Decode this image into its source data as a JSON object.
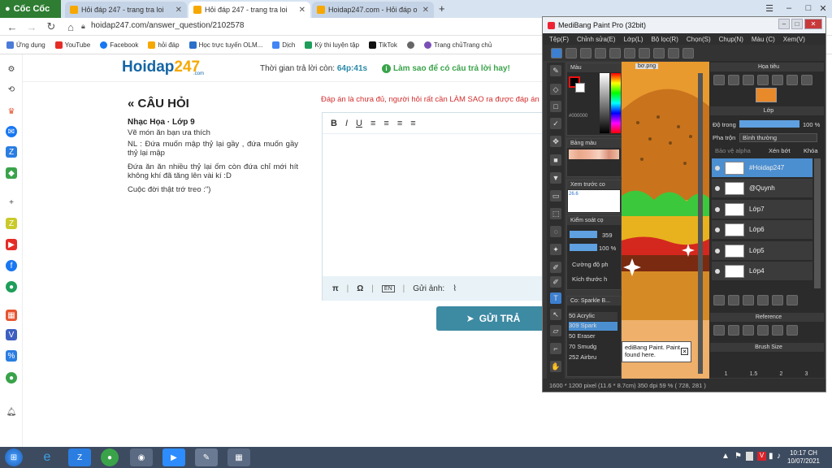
{
  "browser": {
    "brand": "Cốc Cốc",
    "tabs": [
      {
        "title": "Hỏi đáp 247 - trang tra loi",
        "active": false
      },
      {
        "title": "Hỏi đáp 247 - trang tra loi",
        "active": true
      },
      {
        "title": "Hoidap247.com - Hỏi đáp o",
        "active": false
      }
    ],
    "url": "hoidap247.com/answer_question/2102578",
    "bookmarks": [
      "Ứng dụng",
      "YouTube",
      "Facebook",
      "hỏi đáp",
      "Học trực tuyến OLM...",
      "Dịch",
      "Kỳ thi luyện tập",
      "TikTok",
      "Trang chủTrang chủ"
    ]
  },
  "site": {
    "logo_main": "Hoidap",
    "logo_num": "247",
    "logo_sub": ".com",
    "timer_label": "Thời gian trả lời còn:",
    "timer_value": "64p:41s",
    "howto": "Làm sao để có câu trả lời hay!"
  },
  "question": {
    "title": "« CÂU HỎI",
    "subject": "Nhạc Họa · Lớp 9",
    "lines": [
      "Vẽ món ăn bạn ưa thích",
      "NL : Đứa muốn mập thỷ lại gầy , đứa muốn gầy thỷ lại mập",
      "Đứa ăn ăn nhiều thỷ lại ốm còn đứa chỉ mới hít không khí đã tăng lên vài kí :D",
      "Cuộc đời thật trớ treo :\")"
    ]
  },
  "answer": {
    "warning": "Đáp án là chưa đủ, người hỏi rất cần LÀM SAO ra được đáp án",
    "toolbar": [
      "B",
      "I",
      "U",
      "≡",
      "≡",
      "≡",
      "≡"
    ],
    "pi": "π",
    "omega": "Ω",
    "en": "EN",
    "attach_label": "Gửi ảnh:",
    "submit": "GỬI TRẢ"
  },
  "medibang": {
    "title": "MediBang Paint Pro (32bit)",
    "menu": [
      "Tệp(F)",
      "Chỉnh sửa(E)",
      "Lớp(L)",
      "Bộ lọc(R)",
      "Chọn(S)",
      "Chụp(N)",
      "Màu (C)",
      "Xem(V)"
    ],
    "color_panel": "Màu",
    "hex": "#000000",
    "swatch_panel": "Bảng màu",
    "preview_panel": "Xem trước co",
    "preview_zoom": "26.6",
    "control_panel": "Kiểm soát cọ",
    "brush_size": "359",
    "opacity": "100 %",
    "ctrl_1": "Cường độ ph",
    "ctrl_2": "Kích thước h",
    "canvas_tab": "bơ.png",
    "brushes_panel": "Co: Sparkle B...",
    "brushes": [
      {
        "size": "50",
        "name": "Acrylic"
      },
      {
        "size": "309",
        "name": "Spark"
      },
      {
        "size": "50",
        "name": "Eraser"
      },
      {
        "size": "70",
        "name": "Smudg"
      },
      {
        "size": "252",
        "name": "Airbru"
      }
    ],
    "tooltip": "ediBang Paint. Paint found here.",
    "nav_panel": "Họa tiêu",
    "layer_panel": "Lớp",
    "opacity_label": "Độ trong",
    "opacity_value": "100 %",
    "blend_label": "Pha trộn",
    "blend_value": "Bình thường",
    "protect_alpha": "Bảo vệ alpha",
    "clip": "Xén bớt",
    "lock": "Khóa",
    "layers": [
      "#Hoidap247",
      "@Quynh",
      "Lớp7",
      "Lớp6",
      "Lớp5",
      "Lớp4"
    ],
    "reference_panel": "Reference",
    "brush_size_panel": "Brush Size",
    "brush_size_values": [
      "1",
      "1.5",
      "2",
      "3"
    ],
    "status": "1600 * 1200 pixel   (11.6 * 8.7cm)   350 dpi   59 %   ( 728, 281 )"
  },
  "taskbar": {
    "time": "10:17 CH",
    "date": "10/07/2021"
  }
}
